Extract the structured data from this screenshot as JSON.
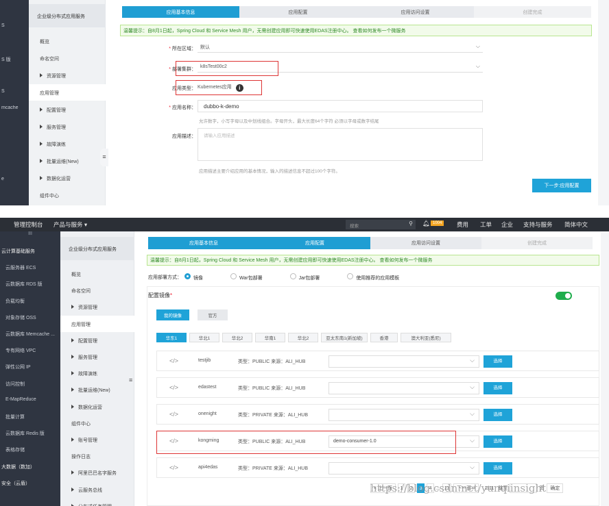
{
  "top": {
    "left_strip": [
      "S",
      "S 版",
      "S",
      "mcache",
      "",
      "",
      "e"
    ],
    "submenu_title": "企业级分布式应用服务",
    "submenu": [
      {
        "label": "概览",
        "arrow": false,
        "active": false
      },
      {
        "label": "命名空间",
        "arrow": false,
        "active": false
      },
      {
        "label": "资源管理",
        "arrow": true,
        "active": false
      },
      {
        "label": "应用管理",
        "arrow": false,
        "active": true
      },
      {
        "label": "配置管理",
        "arrow": true,
        "active": false
      },
      {
        "label": "服务管理",
        "arrow": true,
        "active": false
      },
      {
        "label": "故障演练",
        "arrow": true,
        "active": false
      },
      {
        "label": "批量运维(New)",
        "arrow": true,
        "active": false
      },
      {
        "label": "数据化运营",
        "arrow": true,
        "active": false
      },
      {
        "label": "组件中心",
        "arrow": false,
        "active": false
      }
    ],
    "steps": [
      "应用基本信息",
      "应用配置",
      "应用访问设置",
      "创建完成"
    ],
    "notice": "温馨提示：自8月1日起，Spring Cloud 和 Service Mesh 用户，无需创建应用即可快速使用EDAS注册中心。 查看如何发布一个微服务",
    "form": {
      "region_label": "所在区域：",
      "region_value": "默认",
      "cluster_label": "部署集群：",
      "cluster_value": "k8sTest00c2",
      "type_label": "应用类型：",
      "type_value": "Kubernetes应用",
      "name_label": "应用名称：",
      "name_value": "dubbo-k-demo",
      "name_help": "允许数字，小写字母以及中划线组合。字母开头，最大长度64个字符 必须以字母或数字结尾",
      "desc_label": "应用描述：",
      "desc_placeholder": "请输入应用描述",
      "desc_help": "应用描述主要介绍应用的基本情况，输入的描述信息不超过100个字符。",
      "next_button": "下一步:应用配置"
    }
  },
  "bottom": {
    "topbar": {
      "console": "管理控制台",
      "products": "产品与服务 ▾",
      "search_placeholder": "搜索",
      "badge": "1004",
      "links": [
        "费用",
        "工单",
        "企业",
        "支持与服务",
        "简体中文"
      ]
    },
    "menu_toggle": "III",
    "leftnav": [
      {
        "label": "云计算基础服务",
        "hdr": true
      },
      {
        "label": "云服务器 ECS",
        "hdr": false
      },
      {
        "label": "云数据库 RDS 版",
        "hdr": false
      },
      {
        "label": "负载均衡",
        "hdr": false
      },
      {
        "label": "对象存储 OSS",
        "hdr": false
      },
      {
        "label": "云数据库 Memcache ...",
        "hdr": false
      },
      {
        "label": "专有网络 VPC",
        "hdr": false
      },
      {
        "label": "弹性公网 IP",
        "hdr": false
      },
      {
        "label": "访问控制",
        "hdr": false
      },
      {
        "label": "E-MapReduce",
        "hdr": false
      },
      {
        "label": "批量计算",
        "hdr": false
      },
      {
        "label": "云数据库 Redis 版",
        "hdr": false
      },
      {
        "label": "表格存储",
        "hdr": false
      },
      {
        "label": "大数据（数加）",
        "hdr": true
      },
      {
        "label": "安全（云盾）",
        "hdr": true
      }
    ],
    "submenu_title": "企业级分布式应用服务",
    "submenu": [
      {
        "label": "概览",
        "arrow": false,
        "active": false
      },
      {
        "label": "命名空间",
        "arrow": false,
        "active": false
      },
      {
        "label": "资源管理",
        "arrow": true,
        "active": false
      },
      {
        "label": "应用管理",
        "arrow": false,
        "active": true
      },
      {
        "label": "配置管理",
        "arrow": true,
        "active": false
      },
      {
        "label": "服务管理",
        "arrow": true,
        "active": false
      },
      {
        "label": "故障演练",
        "arrow": true,
        "active": false
      },
      {
        "label": "批量运维(New)",
        "arrow": true,
        "active": false
      },
      {
        "label": "数据化运营",
        "arrow": true,
        "active": false
      },
      {
        "label": "组件中心",
        "arrow": false,
        "active": false
      },
      {
        "label": "账号管理",
        "arrow": true,
        "active": false
      },
      {
        "label": "操作日志",
        "arrow": false,
        "active": false
      },
      {
        "label": "阿里巴巴名字服务",
        "arrow": true,
        "active": false
      },
      {
        "label": "云服务总线",
        "arrow": true,
        "active": false
      },
      {
        "label": "分布式任务管理",
        "arrow": true,
        "active": false
      }
    ],
    "steps": [
      "应用基本信息",
      "应用配置",
      "应用访问设置",
      "创建完成"
    ],
    "notice": "温馨提示：自8月1日起，Spring Cloud 和 Service Mesh 用户，无需创建应用即可快速使用EDAS注册中心。 查看如何发布一个微服务",
    "deploy_label": "应用部署方式：",
    "deploy_options": [
      {
        "label": "镜像",
        "on": true
      },
      {
        "label": "War包部署",
        "on": false
      },
      {
        "label": "Jar包部署",
        "on": false
      },
      {
        "label": "使用推荐的应用模板",
        "on": false
      }
    ],
    "section_title": "配置镜像",
    "image_tabs": [
      "我的镜像",
      "官方"
    ],
    "regions": [
      "华东1",
      "华北1",
      "华北2",
      "华南1",
      "华北2",
      "亚太东南1(新加坡)",
      "香港",
      "澳大利亚(悉尼)"
    ],
    "images": [
      {
        "code": "</>",
        "name": "testjib",
        "meta": "类型：PUBLIC 来源：ALI_HUB",
        "version": "",
        "button": "选择"
      },
      {
        "code": "</>",
        "name": "edastest",
        "meta": "类型：PUBLIC 来源：ALI_HUB",
        "version": "",
        "button": "选择"
      },
      {
        "code": "</>",
        "name": "onenight",
        "meta": "类型：PRIVATE 来源：ALI_HUB",
        "version": "",
        "button": "选择"
      },
      {
        "code": "</>",
        "name": "kongming",
        "meta": "类型：PUBLIC 来源：ALI_HUB",
        "version": "demo-consumer-1.0",
        "button": "选择"
      },
      {
        "code": "</>",
        "name": "api4edas",
        "meta": "类型：PRIVATE 来源：ALI_HUB",
        "version": "",
        "button": "选择"
      }
    ],
    "pager": {
      "prev": "< 上一页",
      "pages": [
        "1",
        "2",
        "3",
        "4",
        "...",
        "11"
      ],
      "next": "下一页 >",
      "total": "2/11",
      "goto": "跳至",
      "page_unit": "页",
      "confirm": "确定"
    },
    "watermark": "https://blog.csdn.net/yunqiinsight"
  }
}
